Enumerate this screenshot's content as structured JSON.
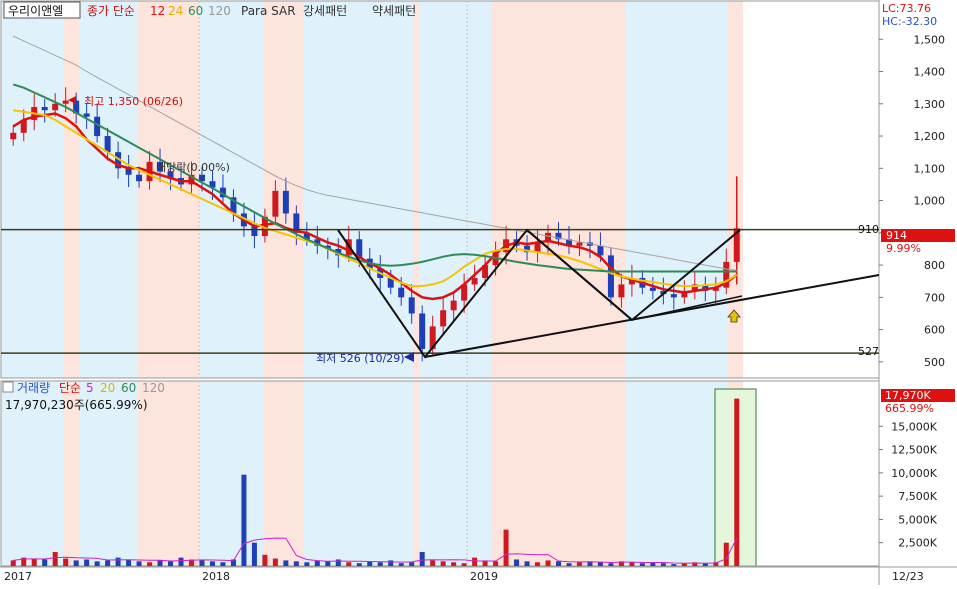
{
  "price_legend": {
    "name": "우리이앤엘",
    "ma_label": "종가 단순",
    "ma_periods": [
      "12",
      "24",
      "60",
      "120"
    ],
    "indicator": "Para SAR",
    "pattern_strong": "강세패턴",
    "pattern_weak": "약세패턴"
  },
  "top_right": {
    "lc": "LC:73.76",
    "hc": "HC:-32.30"
  },
  "current": {
    "price": "914",
    "change": "9.99%"
  },
  "levels": {
    "resistance": "910",
    "support": "527"
  },
  "annotations": {
    "high": "최고 1,350 (06/26)",
    "low": "최저 526 (10/29)",
    "dividend": "배당락(0.00%)"
  },
  "volume_legend": {
    "title": "거래량",
    "ma_label": "단순",
    "ma_periods": [
      "5",
      "20",
      "60",
      "120"
    ],
    "value_text": "17,970,230주(665.99%)"
  },
  "volume_current": {
    "value": "17,970K",
    "pct": "665.99%"
  },
  "x_labels": [
    "2017",
    "2018",
    "2019"
  ],
  "date_box": "12/23",
  "colors": {
    "up": "#d0181e",
    "down": "#1e3fb8",
    "ma12": "#dd1111",
    "ma24": "#f5c400",
    "ma60": "#2e8b57",
    "ma120": "#a5a5a5",
    "zone_blue": "#dff1fa",
    "zone_pink": "#fde4dc",
    "highlight": "#e4f6dc",
    "level": "#3b3b1a"
  },
  "chart_data": [
    {
      "type": "candlestick",
      "title": "우리이앤엘",
      "ylim": [
        450,
        1600
      ],
      "ytick_labels": [
        "1,500",
        "1,400",
        "1,300",
        "1,200",
        "1,100",
        "1,000",
        "900",
        "800",
        "700",
        "600",
        "500"
      ],
      "ytick_values": [
        1500,
        1400,
        1300,
        1200,
        1100,
        1000,
        900,
        800,
        700,
        600,
        500
      ],
      "x_range": [
        "2017",
        "12/23"
      ],
      "high": 1350,
      "low": 526,
      "last_close": 914,
      "last_change_pct": 9.99,
      "horizontal_levels": [
        910,
        527
      ],
      "close_series": [
        1210,
        1250,
        1290,
        1280,
        1300,
        1310,
        1270,
        1260,
        1200,
        1150,
        1100,
        1080,
        1060,
        1120,
        1090,
        1070,
        1050,
        1080,
        1060,
        1040,
        1010,
        960,
        920,
        890,
        950,
        1030,
        960,
        900,
        880,
        860,
        850,
        830,
        880,
        820,
        790,
        760,
        730,
        700,
        650,
        540,
        610,
        660,
        690,
        740,
        760,
        800,
        840,
        880,
        860,
        840,
        870,
        900,
        880,
        860,
        870,
        860,
        830,
        700,
        740,
        760,
        730,
        720,
        710,
        700,
        720,
        740,
        720,
        730,
        810,
        914
      ],
      "series": [
        {
          "name": "12",
          "values": [
            1230,
            1250,
            1260,
            1265,
            1270,
            1255,
            1230,
            1190,
            1160,
            1130,
            1110,
            1100,
            1100,
            1090,
            1080,
            1070,
            1060,
            1060,
            1040,
            1020,
            990,
            960,
            940,
            920,
            925,
            930,
            915,
            905,
            900,
            885,
            870,
            860,
            845,
            825,
            805,
            790,
            770,
            745,
            720,
            700,
            695,
            700,
            715,
            740,
            770,
            800,
            835,
            860,
            870,
            865,
            870,
            875,
            868,
            860,
            855,
            845,
            825,
            790,
            765,
            755,
            745,
            735,
            725,
            720,
            715,
            720,
            725,
            730,
            745,
            770
          ]
        },
        {
          "name": "24",
          "values": [
            1280,
            1275,
            1270,
            1265,
            1250,
            1230,
            1210,
            1190,
            1170,
            1150,
            1130,
            1110,
            1095,
            1080,
            1065,
            1050,
            1035,
            1020,
            1005,
            990,
            975,
            960,
            945,
            930,
            915,
            905,
            895,
            885,
            875,
            865,
            850,
            835,
            820,
            805,
            790,
            775,
            760,
            745,
            735,
            735,
            740,
            750,
            770,
            795,
            815,
            835,
            845,
            850,
            850,
            845,
            840,
            835,
            830,
            822,
            812,
            800,
            788,
            775,
            765,
            758,
            752,
            748,
            742,
            738,
            735,
            735,
            738,
            740,
            750,
            770
          ]
        },
        {
          "name": "60",
          "values": [
            1360,
            1350,
            1335,
            1320,
            1305,
            1290,
            1272,
            1254,
            1236,
            1218,
            1200,
            1182,
            1164,
            1146,
            1128,
            1110,
            1092,
            1074,
            1056,
            1038,
            1020,
            1000,
            982,
            964,
            946,
            928,
            912,
            896,
            880,
            866,
            852,
            838,
            826,
            814,
            806,
            800,
            798,
            800,
            804,
            810,
            818,
            826,
            832,
            834,
            832,
            828,
            822,
            816,
            810,
            805,
            800,
            796,
            792,
            788,
            786,
            784,
            782,
            780,
            780,
            780,
            780,
            780,
            780,
            780,
            780,
            780,
            780,
            780,
            780,
            780
          ]
        },
        {
          "name": "120",
          "values": [
            1510,
            1495,
            1480,
            1465,
            1450,
            1435,
            1420,
            1400,
            1382,
            1364,
            1346,
            1328,
            1310,
            1292,
            1274,
            1256,
            1238,
            1220,
            1202,
            1184,
            1166,
            1148,
            1130,
            1112,
            1094,
            1076,
            1060,
            1046,
            1034,
            1024,
            1016,
            1010,
            1004,
            998,
            992,
            986,
            980,
            974,
            968,
            962,
            956,
            950,
            944,
            938,
            932,
            926,
            920,
            914,
            908,
            902,
            896,
            890,
            884,
            878,
            872,
            866,
            860,
            854,
            848,
            842,
            836,
            830,
            824,
            818,
            812,
            806,
            800,
            794,
            788,
            784
          ]
        }
      ]
    },
    {
      "type": "bar",
      "title": "거래량",
      "ylim": [
        0,
        19000
      ],
      "ytick_labels": [
        "15,000K",
        "12,500K",
        "10,000K",
        "7,500K",
        "5,000K",
        "2,500K"
      ],
      "ytick_values": [
        15000,
        12500,
        10000,
        7500,
        5000,
        2500
      ],
      "last_value_k": 17970,
      "last_change_pct": 665.99,
      "values_k": [
        600,
        900,
        800,
        700,
        1500,
        800,
        600,
        700,
        500,
        600,
        900,
        700,
        500,
        400,
        600,
        500,
        900,
        700,
        600,
        500,
        400,
        700,
        9800,
        2500,
        1200,
        800,
        600,
        500,
        400,
        600,
        500,
        700,
        400,
        300,
        500,
        400,
        600,
        300,
        400,
        1500,
        600,
        500,
        400,
        300,
        900,
        600,
        500,
        3900,
        700,
        500,
        400,
        600,
        500,
        300,
        400,
        500,
        400,
        300,
        500,
        400,
        300,
        400,
        300,
        200,
        300,
        400,
        300,
        400,
        2500,
        17970
      ]
    }
  ]
}
